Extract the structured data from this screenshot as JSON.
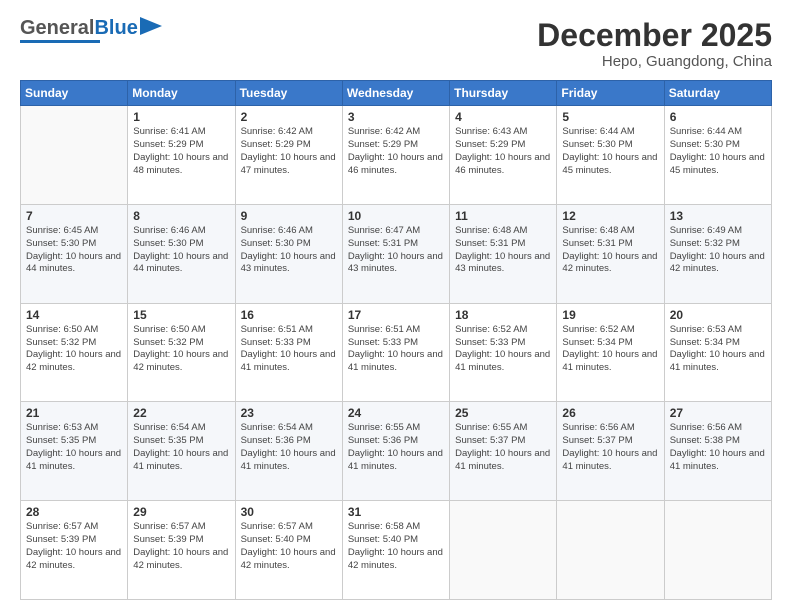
{
  "header": {
    "logo_general": "General",
    "logo_blue": "Blue",
    "month": "December 2025",
    "location": "Hepo, Guangdong, China"
  },
  "weekdays": [
    "Sunday",
    "Monday",
    "Tuesday",
    "Wednesday",
    "Thursday",
    "Friday",
    "Saturday"
  ],
  "weeks": [
    [
      {
        "day": "",
        "sunrise": "",
        "sunset": "",
        "daylight": ""
      },
      {
        "day": "1",
        "sunrise": "Sunrise: 6:41 AM",
        "sunset": "Sunset: 5:29 PM",
        "daylight": "Daylight: 10 hours and 48 minutes."
      },
      {
        "day": "2",
        "sunrise": "Sunrise: 6:42 AM",
        "sunset": "Sunset: 5:29 PM",
        "daylight": "Daylight: 10 hours and 47 minutes."
      },
      {
        "day": "3",
        "sunrise": "Sunrise: 6:42 AM",
        "sunset": "Sunset: 5:29 PM",
        "daylight": "Daylight: 10 hours and 46 minutes."
      },
      {
        "day": "4",
        "sunrise": "Sunrise: 6:43 AM",
        "sunset": "Sunset: 5:29 PM",
        "daylight": "Daylight: 10 hours and 46 minutes."
      },
      {
        "day": "5",
        "sunrise": "Sunrise: 6:44 AM",
        "sunset": "Sunset: 5:30 PM",
        "daylight": "Daylight: 10 hours and 45 minutes."
      },
      {
        "day": "6",
        "sunrise": "Sunrise: 6:44 AM",
        "sunset": "Sunset: 5:30 PM",
        "daylight": "Daylight: 10 hours and 45 minutes."
      }
    ],
    [
      {
        "day": "7",
        "sunrise": "Sunrise: 6:45 AM",
        "sunset": "Sunset: 5:30 PM",
        "daylight": "Daylight: 10 hours and 44 minutes."
      },
      {
        "day": "8",
        "sunrise": "Sunrise: 6:46 AM",
        "sunset": "Sunset: 5:30 PM",
        "daylight": "Daylight: 10 hours and 44 minutes."
      },
      {
        "day": "9",
        "sunrise": "Sunrise: 6:46 AM",
        "sunset": "Sunset: 5:30 PM",
        "daylight": "Daylight: 10 hours and 43 minutes."
      },
      {
        "day": "10",
        "sunrise": "Sunrise: 6:47 AM",
        "sunset": "Sunset: 5:31 PM",
        "daylight": "Daylight: 10 hours and 43 minutes."
      },
      {
        "day": "11",
        "sunrise": "Sunrise: 6:48 AM",
        "sunset": "Sunset: 5:31 PM",
        "daylight": "Daylight: 10 hours and 43 minutes."
      },
      {
        "day": "12",
        "sunrise": "Sunrise: 6:48 AM",
        "sunset": "Sunset: 5:31 PM",
        "daylight": "Daylight: 10 hours and 42 minutes."
      },
      {
        "day": "13",
        "sunrise": "Sunrise: 6:49 AM",
        "sunset": "Sunset: 5:32 PM",
        "daylight": "Daylight: 10 hours and 42 minutes."
      }
    ],
    [
      {
        "day": "14",
        "sunrise": "Sunrise: 6:50 AM",
        "sunset": "Sunset: 5:32 PM",
        "daylight": "Daylight: 10 hours and 42 minutes."
      },
      {
        "day": "15",
        "sunrise": "Sunrise: 6:50 AM",
        "sunset": "Sunset: 5:32 PM",
        "daylight": "Daylight: 10 hours and 42 minutes."
      },
      {
        "day": "16",
        "sunrise": "Sunrise: 6:51 AM",
        "sunset": "Sunset: 5:33 PM",
        "daylight": "Daylight: 10 hours and 41 minutes."
      },
      {
        "day": "17",
        "sunrise": "Sunrise: 6:51 AM",
        "sunset": "Sunset: 5:33 PM",
        "daylight": "Daylight: 10 hours and 41 minutes."
      },
      {
        "day": "18",
        "sunrise": "Sunrise: 6:52 AM",
        "sunset": "Sunset: 5:33 PM",
        "daylight": "Daylight: 10 hours and 41 minutes."
      },
      {
        "day": "19",
        "sunrise": "Sunrise: 6:52 AM",
        "sunset": "Sunset: 5:34 PM",
        "daylight": "Daylight: 10 hours and 41 minutes."
      },
      {
        "day": "20",
        "sunrise": "Sunrise: 6:53 AM",
        "sunset": "Sunset: 5:34 PM",
        "daylight": "Daylight: 10 hours and 41 minutes."
      }
    ],
    [
      {
        "day": "21",
        "sunrise": "Sunrise: 6:53 AM",
        "sunset": "Sunset: 5:35 PM",
        "daylight": "Daylight: 10 hours and 41 minutes."
      },
      {
        "day": "22",
        "sunrise": "Sunrise: 6:54 AM",
        "sunset": "Sunset: 5:35 PM",
        "daylight": "Daylight: 10 hours and 41 minutes."
      },
      {
        "day": "23",
        "sunrise": "Sunrise: 6:54 AM",
        "sunset": "Sunset: 5:36 PM",
        "daylight": "Daylight: 10 hours and 41 minutes."
      },
      {
        "day": "24",
        "sunrise": "Sunrise: 6:55 AM",
        "sunset": "Sunset: 5:36 PM",
        "daylight": "Daylight: 10 hours and 41 minutes."
      },
      {
        "day": "25",
        "sunrise": "Sunrise: 6:55 AM",
        "sunset": "Sunset: 5:37 PM",
        "daylight": "Daylight: 10 hours and 41 minutes."
      },
      {
        "day": "26",
        "sunrise": "Sunrise: 6:56 AM",
        "sunset": "Sunset: 5:37 PM",
        "daylight": "Daylight: 10 hours and 41 minutes."
      },
      {
        "day": "27",
        "sunrise": "Sunrise: 6:56 AM",
        "sunset": "Sunset: 5:38 PM",
        "daylight": "Daylight: 10 hours and 41 minutes."
      }
    ],
    [
      {
        "day": "28",
        "sunrise": "Sunrise: 6:57 AM",
        "sunset": "Sunset: 5:39 PM",
        "daylight": "Daylight: 10 hours and 42 minutes."
      },
      {
        "day": "29",
        "sunrise": "Sunrise: 6:57 AM",
        "sunset": "Sunset: 5:39 PM",
        "daylight": "Daylight: 10 hours and 42 minutes."
      },
      {
        "day": "30",
        "sunrise": "Sunrise: 6:57 AM",
        "sunset": "Sunset: 5:40 PM",
        "daylight": "Daylight: 10 hours and 42 minutes."
      },
      {
        "day": "31",
        "sunrise": "Sunrise: 6:58 AM",
        "sunset": "Sunset: 5:40 PM",
        "daylight": "Daylight: 10 hours and 42 minutes."
      },
      {
        "day": "",
        "sunrise": "",
        "sunset": "",
        "daylight": ""
      },
      {
        "day": "",
        "sunrise": "",
        "sunset": "",
        "daylight": ""
      },
      {
        "day": "",
        "sunrise": "",
        "sunset": "",
        "daylight": ""
      }
    ]
  ]
}
